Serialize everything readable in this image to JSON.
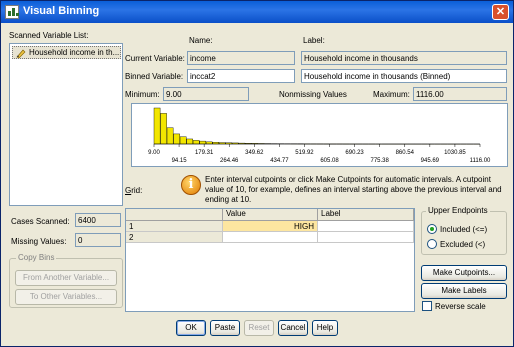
{
  "window": {
    "title": "Visual Binning",
    "close_glyph": "✕"
  },
  "scanned": {
    "label": "Scanned Variable List:",
    "items": [
      "Household income in th..."
    ]
  },
  "current": {
    "name_header": "Name:",
    "label_header": "Label:",
    "current_label": "Current Variable:",
    "current_name": "income",
    "current_var_label": "Household income in thousands",
    "binned_label": "Binned Variable:",
    "binned_name": "inccat2",
    "binned_var_label": "Household income in thousands (Binned)",
    "minimum_label": "Minimum:",
    "minimum_value": "9.00",
    "nonmissing_label": "Nonmissing Values",
    "maximum_label": "Maximum:",
    "maximum_value": "1116.00"
  },
  "chart_data": {
    "type": "bar",
    "xlim": [
      9,
      1116
    ],
    "ticks_top": [
      "9.00",
      "179.31",
      "349.62",
      "519.92",
      "690.23",
      "860.54",
      "1030.85"
    ],
    "ticks_bottom": [
      "94.15",
      "264.46",
      "434.77",
      "605.08",
      "775.38",
      "945.69",
      "1116.00"
    ],
    "values": [
      100,
      85,
      45,
      28,
      20,
      14,
      10,
      8,
      6,
      5,
      4,
      3.5,
      3,
      2.5,
      2,
      1.8,
      1.5,
      1.2,
      1,
      0.9,
      0.8,
      0.7,
      0.6,
      0.5,
      0.45,
      0.4,
      0.35,
      0.3,
      0.3,
      0.25,
      0.2,
      0.2,
      0.15,
      0.15,
      0.1,
      0.1,
      0.1,
      0.1,
      0.08,
      0.08,
      0.06,
      0.06,
      0.05,
      0.05,
      0.04,
      0.04,
      0.03,
      0.03,
      0.02,
      0.02
    ],
    "bar_color": "#f2e600"
  },
  "grid": {
    "label": "Grid:",
    "info_icon": "info-icon",
    "instructions": "Enter interval cutpoints or click Make Cutpoints for automatic intervals. A cutpoint value of 10, for example, defines an interval starting above the previous interval and ending at 10.",
    "headers": [
      "",
      "Value",
      "Label"
    ],
    "rows": [
      {
        "num": "1",
        "value": "HIGH",
        "label": ""
      },
      {
        "num": "2",
        "value": "",
        "label": ""
      }
    ],
    "selected_cell_color": "#fde6a0"
  },
  "stats": {
    "cases_scanned_label": "Cases Scanned:",
    "cases_scanned": "6400",
    "missing_label": "Missing Values:",
    "missing": "0"
  },
  "copy_bins": {
    "title": "Copy Bins",
    "from_button": "From Another Variable...",
    "to_button": "To Other Variables..."
  },
  "upper_endpoints": {
    "title": "Upper Endpoints",
    "included": "Included (<=)",
    "excluded": "Excluded (<)",
    "selected": "included"
  },
  "actions": {
    "make_cutpoints": "Make Cutpoints...",
    "make_labels": "Make Labels",
    "reverse_scale": "Reverse scale"
  },
  "footer": {
    "ok": "OK",
    "paste": "Paste",
    "reset": "Reset",
    "cancel": "Cancel",
    "help": "Help"
  }
}
